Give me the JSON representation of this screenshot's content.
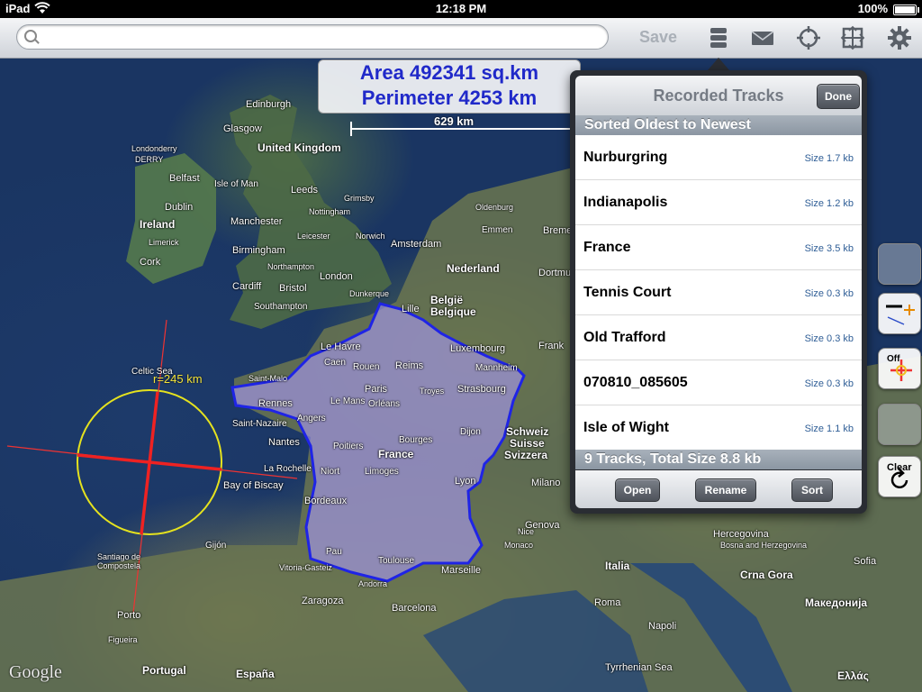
{
  "status": {
    "device": "iPad",
    "time": "12:18 PM",
    "battery": "100%"
  },
  "toolbar": {
    "search_placeholder": "",
    "save_label": "Save"
  },
  "measure": {
    "area": "Area 492341 sq.km",
    "perimeter": "Perimeter 4253 km",
    "scale": "629 km",
    "radius": "r=245 km"
  },
  "panel": {
    "title": "Recorded Tracks",
    "done_label": "Done",
    "section_header": "Sorted Oldest to Newest",
    "tracks": [
      {
        "name": "Nurburgring",
        "size": "Size 1.7 kb"
      },
      {
        "name": "Indianapolis",
        "size": "Size 1.2 kb"
      },
      {
        "name": "France",
        "size": "Size 3.5 kb"
      },
      {
        "name": "Tennis Court",
        "size": "Size 0.3 kb"
      },
      {
        "name": "Old Trafford",
        "size": "Size 0.3 kb"
      },
      {
        "name": "070810_085605",
        "size": "Size 0.3 kb"
      },
      {
        "name": "Isle of Wight",
        "size": "Size 1.1 kb"
      }
    ],
    "summary": "9 Tracks, Total Size 8.8 kb",
    "open_label": "Open",
    "rename_label": "Rename",
    "sort_label": "Sort"
  },
  "side": {
    "off_label": "Off",
    "clear_label": "Clear"
  },
  "map_labels": {
    "edinburgh": "Edinburgh",
    "glasgow": "Glasgow",
    "uk": "United Kingdom",
    "londonderry": "Londonderry",
    "derry": "DERRY",
    "belfast": "Belfast",
    "isle_of_man": "Isle of Man",
    "leeds": "Leeds",
    "dublin": "Dublin",
    "ireland": "Ireland",
    "limerick": "Limerick",
    "cork": "Cork",
    "manchester": "Manchester",
    "leicester": "Leicester",
    "norwich": "Norwich",
    "birmingham": "Birmingham",
    "northampton": "Northampton",
    "london": "London",
    "cardiff": "Cardiff",
    "bristol": "Bristol",
    "southampton": "Southampton",
    "dunkerque": "Dunkerque",
    "amsterdam": "Amsterdam",
    "nederland": "Nederland",
    "belgie": "België",
    "belgique": "Belgique",
    "lille": "Lille",
    "luxembourg": "Luxembourg",
    "le_havre": "Le Havre",
    "caen": "Caen",
    "rouen": "Rouen",
    "reims": "Reims",
    "paris": "Paris",
    "strasbourg": "Strasbourg",
    "mannheim": "Mannheim",
    "saint_malo": "Saint-Malo",
    "rennes": "Rennes",
    "le_mans": "Le Mans",
    "troyes": "Troyes",
    "angers": "Angers",
    "orleans": "Orléans",
    "nantes": "Nantes",
    "saint_nazaire": "Saint-Nazaire",
    "france": "France",
    "dijon": "Dijon",
    "poitiers": "Poitiers",
    "bourges": "Bourges",
    "limoges": "Limoges",
    "niort": "Niort",
    "la_rochelle": "La Rochelle",
    "lyon": "Lyon",
    "bordeaux": "Bordeaux",
    "bay_of_biscay": "Bay of Biscay",
    "celtic_sea": "Celtic Sea",
    "schweiz": "Schweiz",
    "suisse": "Suisse",
    "svizzera": "Svizzera",
    "milano": "Milano",
    "genova": "Genova",
    "monaco": "Monaco",
    "toulouse": "Toulouse",
    "pau": "Pau",
    "marseille": "Marseille",
    "andorra": "Andorra",
    "gijon": "Gijón",
    "santiago": "Santiago de Compostela",
    "vitoria": "Vitoria-Gasteiz",
    "zaragoza": "Zaragoza",
    "barcelona": "Barcelona",
    "porto": "Porto",
    "espana": "España",
    "portugal": "Portugal",
    "figueira": "Figueira",
    "italia": "Italia",
    "roma": "Roma",
    "napoli": "Napoli",
    "tyrrhenian": "Tyrrhenian Sea",
    "hercegovina": "Hercegovina",
    "bosna": "Bosna and Herzegovina",
    "crna_gora": "Crna Gora",
    "macedonia": "Македонија",
    "sofia": "Sofia",
    "ellas": "Ελλάς",
    "frank": "Frank",
    "dortmund": "Dortmund",
    "oldenburg": "Oldenburg",
    "emmen": "Emmen",
    "bremen": "Bremen",
    "grimsby": "Grimsby",
    "nottingham": "Nottingham",
    "nizza": "Nice"
  }
}
